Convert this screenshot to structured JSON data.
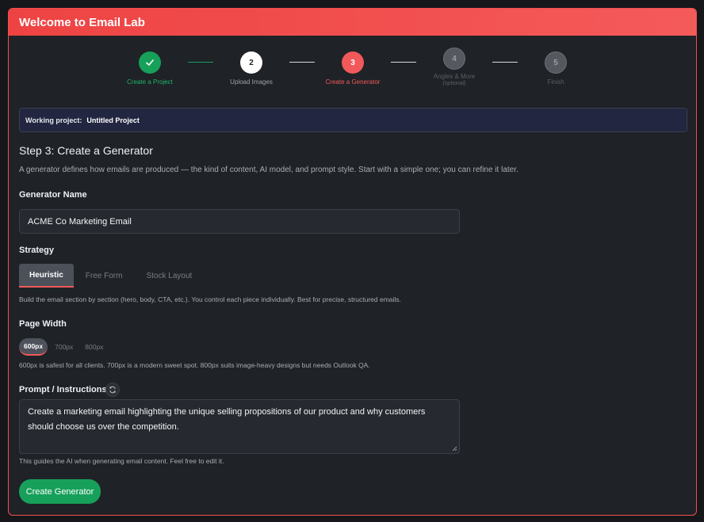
{
  "window": {
    "title": "Welcome to Email Lab"
  },
  "stepper": {
    "steps": [
      {
        "number": "1",
        "label": "Create a Project",
        "status": "done"
      },
      {
        "number": "2",
        "label": "Upload Images",
        "status": "pending"
      },
      {
        "number": "3",
        "label": "Create a Generator",
        "status": "current"
      },
      {
        "number": "4",
        "label": "Angles & More",
        "note": "(optional)",
        "status": "disabled"
      },
      {
        "number": "5",
        "label": "Finish",
        "status": "disabled"
      }
    ]
  },
  "working_project": {
    "label": "Working project:",
    "value": "Untitled Project"
  },
  "main": {
    "title": "Step 3: Create a Generator",
    "description": "A generator defines how emails are produced — the kind of content, AI model, and prompt style. Start with a simple one; you can refine it later."
  },
  "generator_name": {
    "label": "Generator Name",
    "value": "ACME Co Marketing Email"
  },
  "strategy": {
    "label": "Strategy",
    "tabs": [
      "Heuristic",
      "Free Form",
      "Stock Layout"
    ],
    "selected": "Heuristic",
    "help": "Build the email section by section (hero, body, CTA, etc.). You control each piece individually. Best for precise, structured emails."
  },
  "page_width": {
    "label": "Page Width",
    "options": [
      "600px",
      "700px",
      "800px"
    ],
    "selected": "600px",
    "help": "600px is safest for all clients. 700px is a modern sweet spot. 800px suits image-heavy designs but needs Outlook QA."
  },
  "prompt": {
    "label": "Prompt / Instructions",
    "value": "Create a marketing email highlighting the unique selling propositions of our product and why customers should choose us over the competition.",
    "help": "This guides the AI when generating email content. Feel free to edit it."
  },
  "actions": {
    "create_label": "Create Generator"
  },
  "colors": {
    "accent": "#f2595a",
    "success": "#17a05a",
    "background": "#1f2227"
  },
  "icons": {
    "step_done": "check-icon",
    "regenerate": "refresh-icon",
    "resize": "resize-grip-icon"
  }
}
